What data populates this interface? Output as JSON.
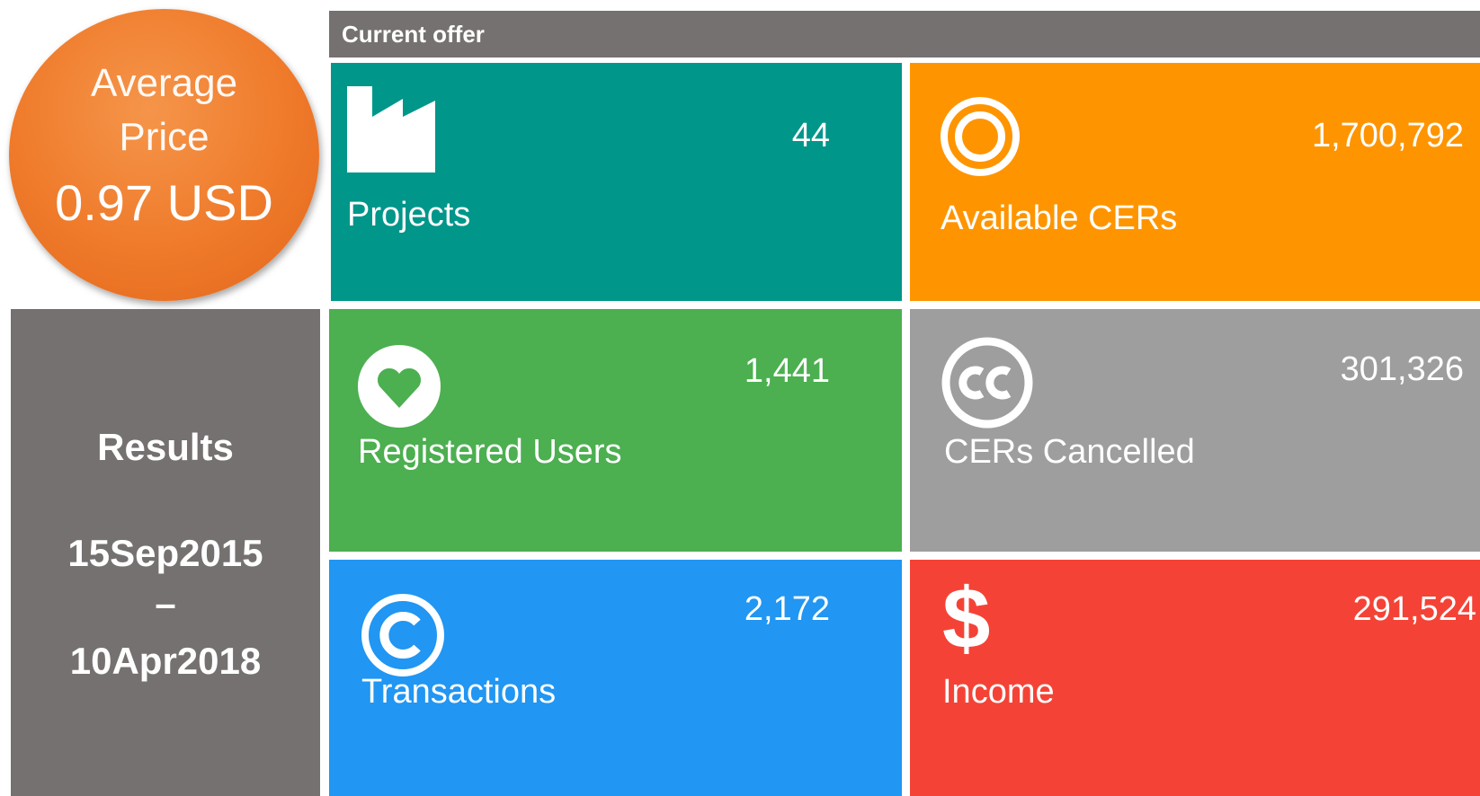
{
  "price": {
    "label_line1": "Average",
    "label_line2": "Price",
    "value": "0.97 USD",
    "color": "#ef7a2a"
  },
  "results": {
    "title": "Results",
    "date_start": "15Sep2015",
    "separator": "–",
    "date_end": "10Apr2018",
    "color": "#757170"
  },
  "offer": {
    "header": "Current offer"
  },
  "tiles": [
    {
      "label": "Projects",
      "value": "44",
      "icon": "factory-icon",
      "color": "#00968a"
    },
    {
      "label": "Available CERs",
      "value": "1,700,792",
      "icon": "target-icon",
      "color": "#fe9500"
    },
    {
      "label": "Registered Users",
      "value": "1,441",
      "icon": "heart-icon",
      "color": "#4caf50"
    },
    {
      "label": "CERs Cancelled",
      "value": "301,326",
      "icon": "creative-commons-icon",
      "color": "#9e9e9e"
    },
    {
      "label": "Transactions",
      "value": "2,172",
      "icon": "copyright-icon",
      "color": "#2196f2"
    },
    {
      "label": "Income",
      "value": "291,524",
      "icon": "dollar-icon",
      "color": "#f44336"
    }
  ]
}
